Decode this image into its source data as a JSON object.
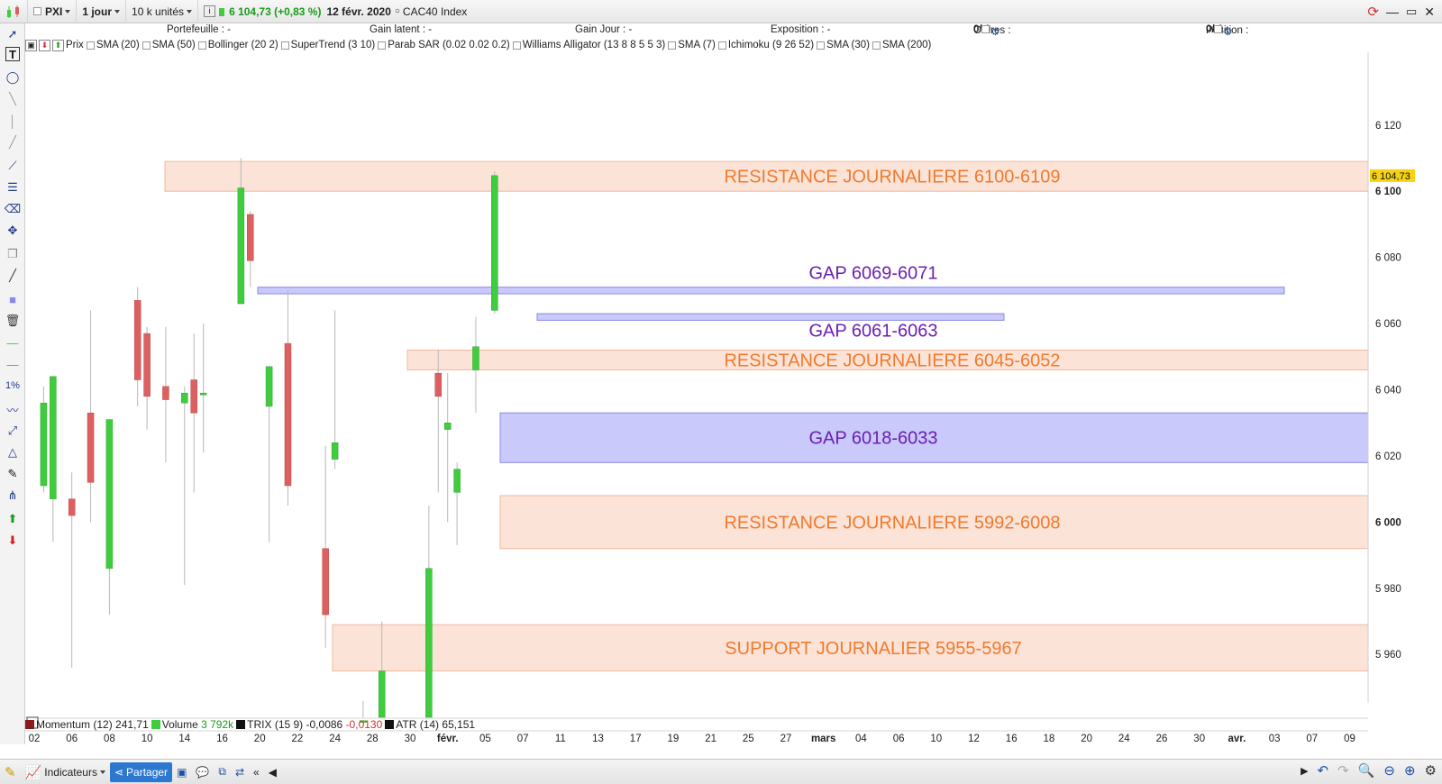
{
  "toolbar": {
    "symbol": "PXI",
    "period": "1 jour",
    "units": "10 k unités",
    "price": "6 104,73 (+0,83 %)",
    "date": "12 févr. 2020",
    "instrument": "CAC40 Index"
  },
  "info": {
    "portefeuille": "Portefeuille : -",
    "gain_latent": "Gain latent : -",
    "gain_jour": "Gain Jour : -",
    "exposition": "Exposition : -",
    "ordres_label": "Ordres :",
    "ordres_a": "0",
    "ordres_b": "/ 0",
    "position_label": "Position :",
    "position_a": "0",
    "position_b": "/ 0"
  },
  "indicators": [
    "Prix",
    "SMA (20)",
    "SMA (50)",
    "Bollinger (20 2)",
    "SuperTrend (3 10)",
    "Parab SAR (0.02 0.02 0.2)",
    "Williams Alligator (13 8 8 5 5 3)",
    "SMA (7)",
    "Ichimoku (9 26 52)",
    "SMA (30)",
    "SMA (200)"
  ],
  "sub_indicators": {
    "momentum_label": "Momentum (12)",
    "momentum_value": "241,71",
    "volume_label": "Volume",
    "volume_value": "3 792k",
    "trix_label": "TRIX (15 9)",
    "trix_value1": "-0,0086",
    "trix_value2": "-0,0130",
    "atr_label": "ATR (14)",
    "atr_value": "65,151"
  },
  "bottom": {
    "indicators_label": "Indicateurs",
    "share_label": "Partager"
  },
  "colors": {
    "up": "#3fcc3f",
    "down": "#dd6060",
    "resistance_fill": "#fbe3d7",
    "resistance_stroke": "#f2b89c",
    "resistance_text": "#f07a2e",
    "gap_fill": "#c9c9fb",
    "gap_stroke": "#8a8ae6",
    "gap_text": "#6b1fb3",
    "current_price_bg": "#f5d313"
  },
  "chart_data": {
    "type": "candlestick",
    "y_ticks": [
      5960,
      5980,
      6000,
      6020,
      6040,
      6060,
      6080,
      6100,
      6120
    ],
    "y_tick_labels": [
      "5 960",
      "5 980",
      "6 000",
      "6 020",
      "6 040",
      "6 060",
      "6 080",
      "6 100",
      "6 120"
    ],
    "bold_ticks": [
      6000,
      6100
    ],
    "ylim": [
      5941,
      6142
    ],
    "current_price": 6104.73,
    "current_price_label": "6 104,73",
    "x_labels": [
      "02",
      "06",
      "08",
      "10",
      "14",
      "16",
      "20",
      "22",
      "24",
      "28",
      "30",
      "févr.",
      "05",
      "07",
      "11",
      "13",
      "17",
      "19",
      "21",
      "25",
      "27",
      "mars",
      "04",
      "06",
      "10",
      "12",
      "16",
      "18",
      "20",
      "24",
      "26",
      "30",
      "avr.",
      "03",
      "07",
      "09"
    ],
    "bold_x_labels": [
      "févr.",
      "mars",
      "avr."
    ],
    "candles": [
      {
        "o": 6011,
        "h": 6041,
        "l": 6009,
        "c": 6036
      },
      {
        "o": 6007,
        "h": 6040,
        "l": 5994,
        "c": 6044
      },
      {
        "o": 6007,
        "h": 6015,
        "l": 5956,
        "c": 6002
      },
      {
        "o": 6033,
        "h": 6064,
        "l": 6000,
        "c": 6012
      },
      {
        "o": 5986,
        "h": 6026,
        "l": 5972,
        "c": 6031
      },
      {
        "o": 6067,
        "h": 6071,
        "l": 6035,
        "c": 6043
      },
      {
        "o": 6057,
        "h": 6059,
        "l": 6028,
        "c": 6038
      },
      {
        "o": 6041,
        "h": 6059,
        "l": 6018,
        "c": 6037
      },
      {
        "o": 6036,
        "h": 6041,
        "l": 5981,
        "c": 6039
      },
      {
        "o": 6043,
        "h": 6057,
        "l": 6009,
        "c": 6033
      },
      {
        "o": 6039,
        "h": 6060,
        "l": 6021,
        "c": 6039
      },
      {
        "o": 6066,
        "h": 6110,
        "l": 6066,
        "c": 6101
      },
      {
        "o": 6093,
        "h": 6094,
        "l": 6071,
        "c": 6079
      },
      {
        "o": 6035,
        "h": 6045,
        "l": 5994,
        "c": 6047
      },
      {
        "o": 6054,
        "h": 6070,
        "l": 6005,
        "c": 6011
      },
      {
        "o": 5992,
        "h": 6023,
        "l": 5962,
        "c": 5972
      },
      {
        "o": 6019,
        "h": 6064,
        "l": 6016,
        "c": 6024
      },
      {
        "o": 5940,
        "h": 5946,
        "l": 5940,
        "c": 5940
      },
      {
        "o": 5940,
        "h": 5970,
        "l": 5940,
        "c": 5955
      },
      {
        "o": 5940,
        "h": 6005,
        "l": 5940,
        "c": 5986
      },
      {
        "o": 6045,
        "h": 6052,
        "l": 6009,
        "c": 6038
      },
      {
        "o": 6028,
        "h": 6045,
        "l": 6000,
        "c": 6030
      },
      {
        "o": 6009,
        "h": 6018,
        "l": 5993,
        "c": 6016
      },
      {
        "o": 6046,
        "h": 6062,
        "l": 6033,
        "c": 6053
      },
      {
        "o": 6064,
        "h": 6106,
        "l": 6063,
        "c": 6104.73
      }
    ],
    "zones": [
      {
        "label": "RESISTANCE JOURNALIERE 6100-6109",
        "kind": "resistance",
        "low": 6100,
        "high": 6109
      },
      {
        "label": "GAP 6069-6071",
        "kind": "gap",
        "low": 6069,
        "high": 6071
      },
      {
        "label": "GAP 6061-6063",
        "kind": "gap",
        "low": 6061,
        "high": 6063
      },
      {
        "label": "RESISTANCE JOURNALIERE 6045-6052",
        "kind": "resistance",
        "low": 6046,
        "high": 6052
      },
      {
        "label": "GAP 6018-6033",
        "kind": "gap",
        "low": 6018,
        "high": 6033
      },
      {
        "label": "RESISTANCE JOURNALIERE 5992-6008",
        "kind": "resistance",
        "low": 5992,
        "high": 6008
      },
      {
        "label": "SUPPORT JOURNALIER 5955-5967",
        "kind": "resistance",
        "low": 5955,
        "high": 5969
      }
    ]
  }
}
